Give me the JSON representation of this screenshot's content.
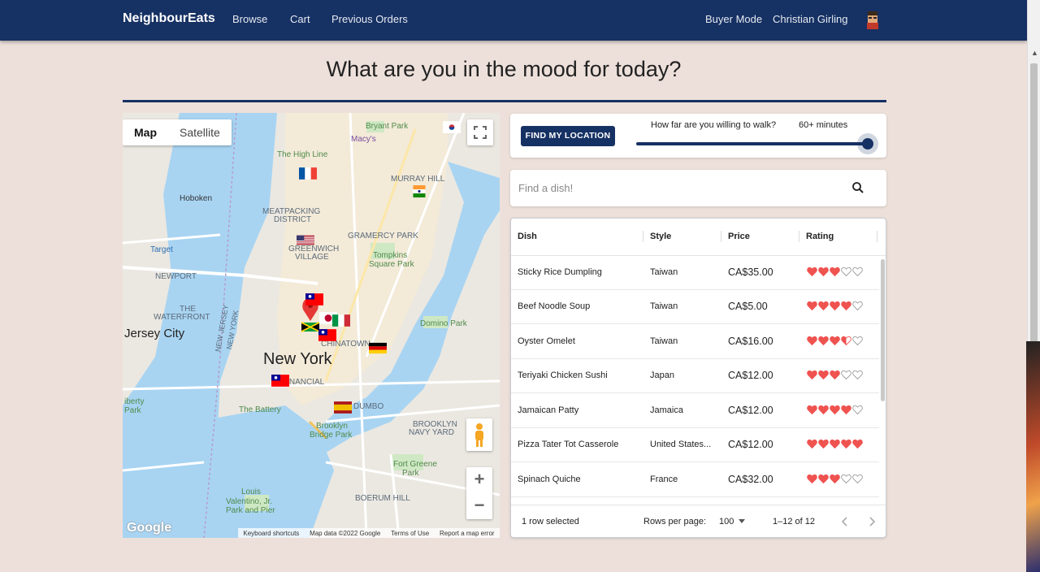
{
  "header": {
    "brand": "NeighbourEats",
    "nav": [
      "Browse",
      "Cart",
      "Previous Orders"
    ],
    "mode": "Buyer Mode",
    "user": "Christian Girling"
  },
  "page_title": "What are you in the mood for today?",
  "map": {
    "type_options": [
      "Map",
      "Satellite"
    ],
    "selected_type": "Map",
    "labels": {
      "hoboken": "Hoboken",
      "jersey_city": "Jersey City",
      "new_york": "New York",
      "meatpacking": "MEATPACKING",
      "district": "DISTRICT",
      "greenwich": "GREENWICH",
      "village": "VILLAGE",
      "gramercy": "GRAMERCY PARK",
      "murray": "MURRAY HILL",
      "bryant": "Bryant Park",
      "macys": "Macy's",
      "highline": "The High Line",
      "tompkins": "Tompkins",
      "square_park": "Square Park",
      "target": "Target",
      "newport": "NEWPORT",
      "the": "THE",
      "waterfront": "WATERFRONT",
      "chinatown": "CHINATOWN",
      "financial": "FINANCIAL",
      "dumbo": "DUMBO",
      "battery": "The Battery",
      "brooklyn": "Brooklyn",
      "bridge_park": "Bridge Park",
      "navy": "BROOKLYN",
      "navy_yard": "NAVY YARD",
      "fort": "Fort Greene",
      "park": "Park",
      "boerum": "BOERUM HILL",
      "valentino": "Louis",
      "valentino2": "Valentino, Jr.",
      "valentino3": "Park and Pier",
      "domino": "Domino Park",
      "liberty": "iberty",
      "liberty2": "Park",
      "nj_state1": "NEW JERSEY",
      "nj_state2": "NEW YORK"
    },
    "attribution": [
      "Keyboard shortcuts",
      "Map data ©2022 Google",
      "Terms of Use",
      "Report a map error"
    ],
    "google": "Google",
    "flag_icons": [
      "taiwan-flag",
      "france-flag",
      "india-flag",
      "usa-flag",
      "japan-flag",
      "italy-flag",
      "jamaica-flag",
      "germany-flag",
      "spain-flag",
      "south-korea-flag"
    ]
  },
  "location": {
    "button_label": "FIND MY LOCATION",
    "walk_question": "How far are you willing to walk?",
    "walk_value": "60+ minutes",
    "slider_fraction": 1.0
  },
  "search": {
    "placeholder": "Find a dish!"
  },
  "table": {
    "columns": [
      "Dish",
      "Style",
      "Price",
      "Rating"
    ],
    "rows": [
      {
        "dish": "Sticky Rice Dumpling",
        "style": "Taiwan",
        "price": "CA$35.00",
        "rating": 3
      },
      {
        "dish": "Beef Noodle Soup",
        "style": "Taiwan",
        "price": "CA$5.00",
        "rating": 4
      },
      {
        "dish": "Oyster Omelet",
        "style": "Taiwan",
        "price": "CA$16.00",
        "rating": 3.5
      },
      {
        "dish": "Teriyaki Chicken Sushi",
        "style": "Japan",
        "price": "CA$12.00",
        "rating": 3
      },
      {
        "dish": "Jamaican Patty",
        "style": "Jamaica",
        "price": "CA$12.00",
        "rating": 4
      },
      {
        "dish": "Pizza Tater Tot Casserole",
        "style": "United States...",
        "price": "CA$12.00",
        "rating": 5
      },
      {
        "dish": "Spinach Quiche",
        "style": "France",
        "price": "CA$32.00",
        "rating": 3
      }
    ],
    "footer": {
      "selected": "1 row selected",
      "rows_per_page_label": "Rows per page:",
      "rows_per_page": "100",
      "range": "1–12 of 12"
    }
  },
  "colors": {
    "primary": "#163163",
    "heart": "#ef5350",
    "background": "#ede0da"
  }
}
